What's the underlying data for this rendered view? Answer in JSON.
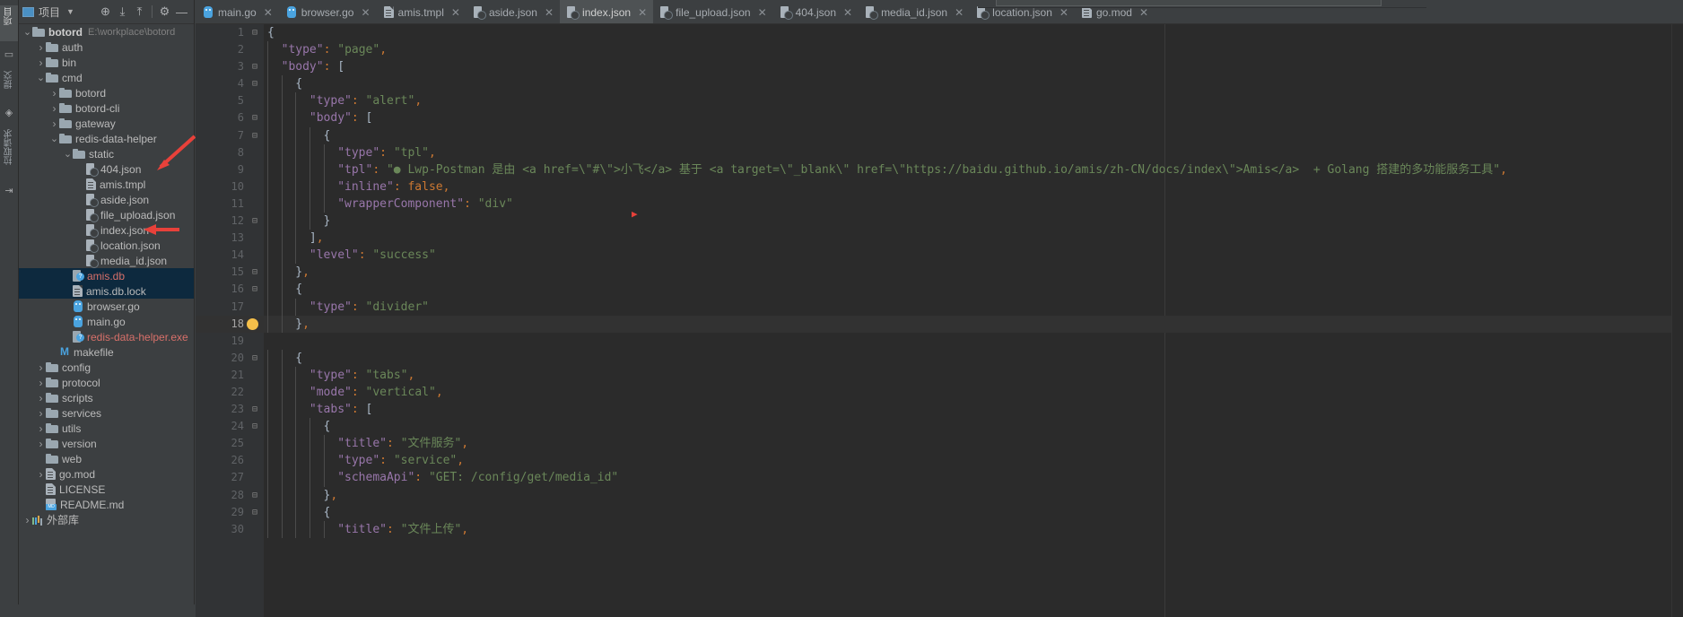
{
  "window": {
    "theme_bg": "#3c3f41",
    "editor_bg": "#2b2b2b",
    "accent": "#4a90c4",
    "annotation_color": "#e8413a"
  },
  "left_strip": {
    "items": [
      {
        "label": "项目",
        "name": "tool-window-project",
        "active": true
      },
      {
        "label": "",
        "name": "tool-window-structure-icon",
        "active": false
      },
      {
        "label": "提交",
        "name": "tool-window-commit",
        "active": false
      },
      {
        "label": "",
        "name": "tool-window-pull-requests-icon",
        "active": false
      },
      {
        "label": "拉取请求",
        "name": "tool-window-pull-requests",
        "active": false
      },
      {
        "label": "",
        "name": "tool-window-bookmarks-icon",
        "active": false
      }
    ]
  },
  "project_panel": {
    "title": "项目",
    "header_icons": [
      {
        "name": "locate-icon",
        "glyph": "⊕"
      },
      {
        "name": "expand-all-icon",
        "glyph": "⤓"
      },
      {
        "name": "collapse-all-icon",
        "glyph": "⤒"
      },
      {
        "name": "gear-icon",
        "glyph": "⚙"
      },
      {
        "name": "hide-icon",
        "glyph": "—"
      }
    ],
    "tree": [
      {
        "depth": 0,
        "label": "botord",
        "sub": "E:\\workplace\\botord",
        "icon": "folder",
        "state": "expanded",
        "bold": true
      },
      {
        "depth": 1,
        "label": "auth",
        "icon": "folder",
        "state": "collapsed"
      },
      {
        "depth": 1,
        "label": "bin",
        "icon": "folder",
        "state": "collapsed"
      },
      {
        "depth": 1,
        "label": "cmd",
        "icon": "folder",
        "state": "expanded"
      },
      {
        "depth": 2,
        "label": "botord",
        "icon": "folder",
        "state": "collapsed"
      },
      {
        "depth": 2,
        "label": "botord-cli",
        "icon": "folder",
        "state": "collapsed"
      },
      {
        "depth": 2,
        "label": "gateway",
        "icon": "folder",
        "state": "collapsed"
      },
      {
        "depth": 2,
        "label": "redis-data-helper",
        "icon": "folder",
        "state": "expanded"
      },
      {
        "depth": 3,
        "label": "static",
        "icon": "folder",
        "state": "expanded"
      },
      {
        "depth": 4,
        "label": "404.json",
        "icon": "json",
        "state": "leaf"
      },
      {
        "depth": 4,
        "label": "amis.tmpl",
        "icon": "file",
        "state": "leaf"
      },
      {
        "depth": 4,
        "label": "aside.json",
        "icon": "json",
        "state": "leaf"
      },
      {
        "depth": 4,
        "label": "file_upload.json",
        "icon": "json",
        "state": "leaf"
      },
      {
        "depth": 4,
        "label": "index.json",
        "icon": "json",
        "state": "leaf"
      },
      {
        "depth": 4,
        "label": "location.json",
        "icon": "json",
        "state": "leaf"
      },
      {
        "depth": 4,
        "label": "media_id.json",
        "icon": "json",
        "state": "leaf"
      },
      {
        "depth": 3,
        "label": "amis.db",
        "icon": "db",
        "state": "leaf",
        "selected": true,
        "color": "red"
      },
      {
        "depth": 3,
        "label": "amis.db.lock",
        "icon": "file",
        "state": "leaf",
        "selected": true
      },
      {
        "depth": 3,
        "label": "browser.go",
        "icon": "go",
        "state": "leaf"
      },
      {
        "depth": 3,
        "label": "main.go",
        "icon": "go",
        "state": "leaf"
      },
      {
        "depth": 3,
        "label": "redis-data-helper.exe",
        "icon": "db",
        "state": "leaf",
        "color": "red"
      },
      {
        "depth": 2,
        "label": "makefile",
        "icon": "m",
        "state": "leaf"
      },
      {
        "depth": 1,
        "label": "config",
        "icon": "folder",
        "state": "collapsed"
      },
      {
        "depth": 1,
        "label": "protocol",
        "icon": "folder",
        "state": "collapsed"
      },
      {
        "depth": 1,
        "label": "scripts",
        "icon": "folder",
        "state": "collapsed"
      },
      {
        "depth": 1,
        "label": "services",
        "icon": "folder",
        "state": "collapsed"
      },
      {
        "depth": 1,
        "label": "utils",
        "icon": "folder",
        "state": "collapsed"
      },
      {
        "depth": 1,
        "label": "version",
        "icon": "folder",
        "state": "collapsed"
      },
      {
        "depth": 1,
        "label": "web",
        "icon": "folder",
        "state": "leaf"
      },
      {
        "depth": 1,
        "label": "go.mod",
        "icon": "file",
        "state": "collapsed"
      },
      {
        "depth": 1,
        "label": "LICENSE",
        "icon": "file",
        "state": "leaf"
      },
      {
        "depth": 1,
        "label": "README.md",
        "icon": "md",
        "state": "leaf"
      },
      {
        "depth": 0,
        "label": "外部库",
        "icon": "lib",
        "state": "collapsed"
      }
    ]
  },
  "editor": {
    "tabs": [
      {
        "label": "main.go",
        "icon": "go",
        "active": false
      },
      {
        "label": "browser.go",
        "icon": "go",
        "active": false
      },
      {
        "label": "amis.tmpl",
        "icon": "file",
        "active": false
      },
      {
        "label": "aside.json",
        "icon": "json",
        "active": false
      },
      {
        "label": "index.json",
        "icon": "json",
        "active": true
      },
      {
        "label": "file_upload.json",
        "icon": "json",
        "active": false
      },
      {
        "label": "404.json",
        "icon": "json",
        "active": false
      },
      {
        "label": "media_id.json",
        "icon": "json",
        "active": false
      },
      {
        "label": "location.json",
        "icon": "json",
        "active": false
      },
      {
        "label": "go.mod",
        "icon": "file",
        "active": false
      }
    ],
    "close_glyph": "✕",
    "current_line": 18,
    "lines": [
      {
        "n": 1,
        "fold": "minus",
        "indent": 0,
        "tokens": [
          {
            "t": "{",
            "c": "p"
          }
        ]
      },
      {
        "n": 2,
        "fold": "",
        "indent": 1,
        "tokens": [
          {
            "t": "\"type\"",
            "c": "k"
          },
          {
            "t": ":",
            "c": "c"
          },
          {
            "t": " ",
            "c": "p"
          },
          {
            "t": "\"page\"",
            "c": "s"
          },
          {
            "t": ",",
            "c": "c"
          }
        ]
      },
      {
        "n": 3,
        "fold": "minus",
        "indent": 1,
        "tokens": [
          {
            "t": "\"body\"",
            "c": "k"
          },
          {
            "t": ":",
            "c": "c"
          },
          {
            "t": " ",
            "c": "p"
          },
          {
            "t": "[",
            "c": "p"
          }
        ]
      },
      {
        "n": 4,
        "fold": "minus",
        "indent": 2,
        "tokens": [
          {
            "t": "{",
            "c": "p"
          }
        ]
      },
      {
        "n": 5,
        "fold": "",
        "indent": 3,
        "tokens": [
          {
            "t": "\"type\"",
            "c": "k"
          },
          {
            "t": ":",
            "c": "c"
          },
          {
            "t": " ",
            "c": "p"
          },
          {
            "t": "\"alert\"",
            "c": "s"
          },
          {
            "t": ",",
            "c": "c"
          }
        ]
      },
      {
        "n": 6,
        "fold": "minus",
        "indent": 3,
        "tokens": [
          {
            "t": "\"body\"",
            "c": "k"
          },
          {
            "t": ":",
            "c": "c"
          },
          {
            "t": " ",
            "c": "p"
          },
          {
            "t": "[",
            "c": "p"
          }
        ]
      },
      {
        "n": 7,
        "fold": "minus",
        "indent": 4,
        "tokens": [
          {
            "t": "{",
            "c": "p"
          }
        ]
      },
      {
        "n": 8,
        "fold": "",
        "indent": 5,
        "tokens": [
          {
            "t": "\"type\"",
            "c": "k"
          },
          {
            "t": ":",
            "c": "c"
          },
          {
            "t": " ",
            "c": "p"
          },
          {
            "t": "\"tpl\"",
            "c": "s"
          },
          {
            "t": ",",
            "c": "c"
          }
        ]
      },
      {
        "n": 9,
        "fold": "",
        "indent": 5,
        "tokens": [
          {
            "t": "\"tpl\"",
            "c": "k"
          },
          {
            "t": ":",
            "c": "c"
          },
          {
            "t": " ",
            "c": "p"
          },
          {
            "t": "\"● Lwp-Postman 是由 <a href=\\\"#\\\">小飞</a> 基于 <a target=\\\"_blank\\\" href=\\\"https://baidu.github.io/amis/zh-CN/docs/index\\\">Amis</a>  + Golang 搭建的多功能服务工具\"",
            "c": "s"
          },
          {
            "t": ",",
            "c": "c"
          }
        ]
      },
      {
        "n": 10,
        "fold": "",
        "indent": 5,
        "tokens": [
          {
            "t": "\"inline\"",
            "c": "k"
          },
          {
            "t": ":",
            "c": "c"
          },
          {
            "t": " ",
            "c": "p"
          },
          {
            "t": "false",
            "c": "c"
          },
          {
            "t": ",",
            "c": "c"
          }
        ]
      },
      {
        "n": 11,
        "fold": "",
        "indent": 5,
        "tokens": [
          {
            "t": "\"wrapperComponent\"",
            "c": "k"
          },
          {
            "t": ":",
            "c": "c"
          },
          {
            "t": " ",
            "c": "p"
          },
          {
            "t": "\"div\"",
            "c": "s"
          }
        ]
      },
      {
        "n": 12,
        "fold": "minus",
        "indent": 4,
        "tokens": [
          {
            "t": "}",
            "c": "p"
          }
        ]
      },
      {
        "n": 13,
        "fold": "",
        "indent": 3,
        "tokens": [
          {
            "t": "]",
            "c": "p"
          },
          {
            "t": ",",
            "c": "c"
          }
        ]
      },
      {
        "n": 14,
        "fold": "",
        "indent": 3,
        "tokens": [
          {
            "t": "\"level\"",
            "c": "k"
          },
          {
            "t": ":",
            "c": "c"
          },
          {
            "t": " ",
            "c": "p"
          },
          {
            "t": "\"success\"",
            "c": "s"
          }
        ]
      },
      {
        "n": 15,
        "fold": "minus",
        "indent": 2,
        "tokens": [
          {
            "t": "}",
            "c": "p"
          },
          {
            "t": ",",
            "c": "c"
          }
        ]
      },
      {
        "n": 16,
        "fold": "minus",
        "indent": 2,
        "tokens": [
          {
            "t": "{",
            "c": "p"
          }
        ]
      },
      {
        "n": 17,
        "fold": "",
        "indent": 3,
        "tokens": [
          {
            "t": "\"type\"",
            "c": "k"
          },
          {
            "t": ":",
            "c": "c"
          },
          {
            "t": " ",
            "c": "p"
          },
          {
            "t": "\"divider\"",
            "c": "s"
          }
        ]
      },
      {
        "n": 18,
        "fold": "minus",
        "indent": 2,
        "tokens": [
          {
            "t": "}",
            "c": "p"
          },
          {
            "t": ",",
            "c": "c"
          }
        ],
        "bulb": true
      },
      {
        "n": 19,
        "fold": "",
        "indent": 0,
        "tokens": []
      },
      {
        "n": 20,
        "fold": "minus",
        "indent": 2,
        "tokens": [
          {
            "t": "{",
            "c": "p"
          }
        ]
      },
      {
        "n": 21,
        "fold": "",
        "indent": 3,
        "tokens": [
          {
            "t": "\"type\"",
            "c": "k"
          },
          {
            "t": ":",
            "c": "c"
          },
          {
            "t": " ",
            "c": "p"
          },
          {
            "t": "\"tabs\"",
            "c": "s"
          },
          {
            "t": ",",
            "c": "c"
          }
        ]
      },
      {
        "n": 22,
        "fold": "",
        "indent": 3,
        "tokens": [
          {
            "t": "\"mode\"",
            "c": "k"
          },
          {
            "t": ":",
            "c": "c"
          },
          {
            "t": " ",
            "c": "p"
          },
          {
            "t": "\"vertical\"",
            "c": "s"
          },
          {
            "t": ",",
            "c": "c"
          }
        ]
      },
      {
        "n": 23,
        "fold": "minus",
        "indent": 3,
        "tokens": [
          {
            "t": "\"tabs\"",
            "c": "k"
          },
          {
            "t": ":",
            "c": "c"
          },
          {
            "t": " ",
            "c": "p"
          },
          {
            "t": "[",
            "c": "p"
          }
        ]
      },
      {
        "n": 24,
        "fold": "minus",
        "indent": 4,
        "tokens": [
          {
            "t": "{",
            "c": "p"
          }
        ]
      },
      {
        "n": 25,
        "fold": "",
        "indent": 5,
        "tokens": [
          {
            "t": "\"title\"",
            "c": "k"
          },
          {
            "t": ":",
            "c": "c"
          },
          {
            "t": " ",
            "c": "p"
          },
          {
            "t": "\"文件服务\"",
            "c": "s"
          },
          {
            "t": ",",
            "c": "c"
          }
        ]
      },
      {
        "n": 26,
        "fold": "",
        "indent": 5,
        "tokens": [
          {
            "t": "\"type\"",
            "c": "k"
          },
          {
            "t": ":",
            "c": "c"
          },
          {
            "t": " ",
            "c": "p"
          },
          {
            "t": "\"service\"",
            "c": "s"
          },
          {
            "t": ",",
            "c": "c"
          }
        ]
      },
      {
        "n": 27,
        "fold": "",
        "indent": 5,
        "tokens": [
          {
            "t": "\"schemaApi\"",
            "c": "k"
          },
          {
            "t": ":",
            "c": "c"
          },
          {
            "t": " ",
            "c": "p"
          },
          {
            "t": "\"GET: /config/get/media_id\"",
            "c": "s"
          }
        ]
      },
      {
        "n": 28,
        "fold": "minus",
        "indent": 4,
        "tokens": [
          {
            "t": "}",
            "c": "p"
          },
          {
            "t": ",",
            "c": "c"
          }
        ]
      },
      {
        "n": 29,
        "fold": "minus",
        "indent": 4,
        "tokens": [
          {
            "t": "{",
            "c": "p"
          }
        ]
      },
      {
        "n": 30,
        "fold": "",
        "indent": 5,
        "tokens": [
          {
            "t": "\"title\"",
            "c": "k"
          },
          {
            "t": ":",
            "c": "c"
          },
          {
            "t": " ",
            "c": "p"
          },
          {
            "t": "\"文件上传\"",
            "c": "s"
          },
          {
            "t": ",",
            "c": "c"
          }
        ]
      }
    ]
  },
  "annotations": [
    {
      "name": "red-arrow-static-folder",
      "target": "404.json / static row"
    },
    {
      "name": "red-arrow-index-json",
      "target": "index.json row"
    },
    {
      "name": "mouse-cursor-marker",
      "target": "editor line 10 area"
    }
  ]
}
